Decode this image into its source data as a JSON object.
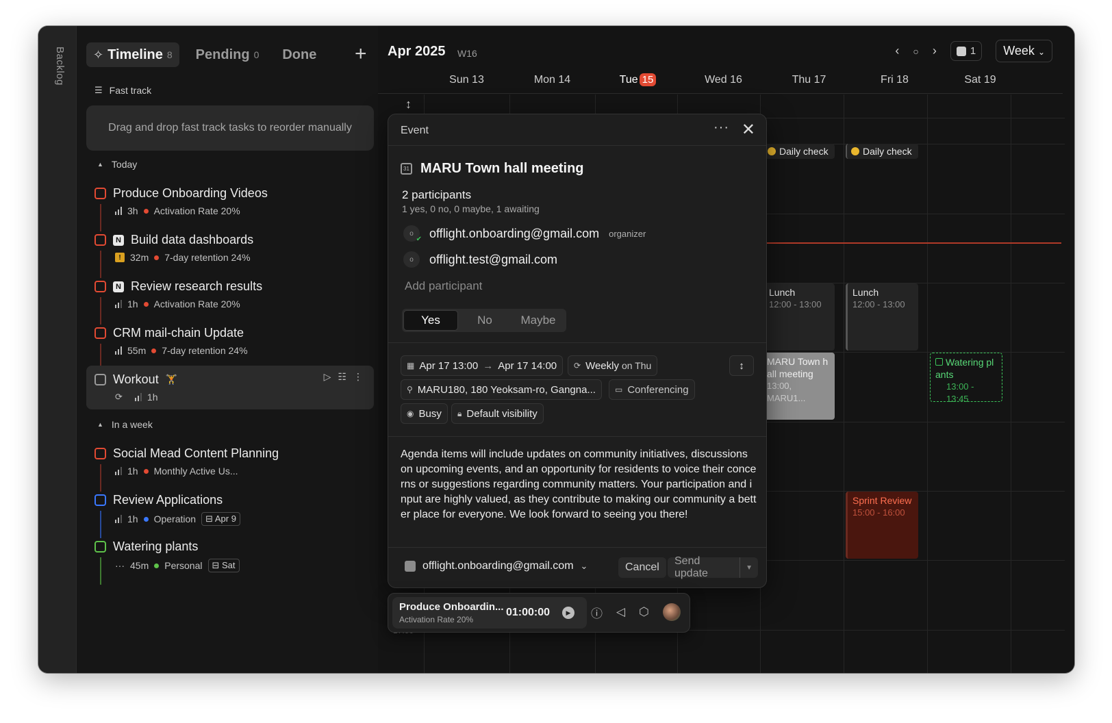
{
  "backlog_label": "Backlog",
  "tabs": [
    {
      "label": "Timeline",
      "count": "8"
    },
    {
      "label": "Pending",
      "count": "0"
    },
    {
      "label": "Done",
      "count": ""
    }
  ],
  "add_label": "+",
  "fast_track": {
    "label": "Fast track",
    "drop_hint": "Drag and drop fast track tasks to reorder manually"
  },
  "sections": {
    "today": "Today",
    "in_a_week": "In a week"
  },
  "tasks": [
    {
      "title": "Produce Onboarding Videos",
      "duration": "3h",
      "goal": "Activation Rate 20%",
      "goal_color": "#e24a33",
      "checkbox_color": "#e24a33"
    },
    {
      "title": "Build data dashboards",
      "duration": "32m",
      "goal": "7-day retention 24%",
      "goal_color": "#e24a33",
      "checkbox_color": "#e24a33",
      "app_icon": "N"
    },
    {
      "title": "Review research results",
      "duration": "1h",
      "goal": "Activation Rate 20%",
      "goal_color": "#e24a33",
      "checkbox_color": "#e24a33",
      "app_icon": "N"
    },
    {
      "title": "CRM mail-chain Update",
      "duration": "55m",
      "goal": "7-day retention 24%",
      "goal_color": "#e24a33",
      "checkbox_color": "#e24a33"
    },
    {
      "title": "Workout",
      "emoji": "🏋",
      "duration": "1h",
      "checkbox_color": "#9a9a9a"
    },
    {
      "title": "Social Mead Content Planning",
      "duration": "1h",
      "goal": "Monthly Active Us...",
      "goal_color": "#e24a33",
      "checkbox_color": "#e24a33"
    },
    {
      "title": "Review Applications",
      "duration": "1h",
      "goal": "Operation",
      "goal_color": "#3a78ff",
      "due": "Apr 9",
      "checkbox_color": "#3a78ff"
    },
    {
      "title": "Watering plants",
      "duration": "45m",
      "goal": "Personal",
      "goal_color": "#5ec24a",
      "due": "Sat",
      "checkbox_color": "#5ec24a",
      "duration_icon": "···"
    }
  ],
  "calendar": {
    "month": "Apr 2025",
    "week": "W16",
    "filter_count": "1",
    "view": "Week",
    "days": [
      "Sun 13",
      "Mon 14",
      "Tue",
      "Wed 16",
      "Thu 17",
      "Fri 18",
      "Sat 19"
    ],
    "today_num": "15",
    "hour_label": "17:00",
    "events": {
      "daily_thu": "Daily check",
      "daily_fri": "Daily check",
      "lunch_thu": {
        "title": "Lunch",
        "time": "12:00 - 13:00"
      },
      "lunch_fri": {
        "title": "Lunch",
        "time": "12:00 - 13:00"
      },
      "maru": {
        "title": "MARU Town h all meeting",
        "time": "13:00, MARU1..."
      },
      "water": {
        "title": "Watering pl ants",
        "time": "13:00 - 13:45"
      },
      "sprint": {
        "title": "Sprint Review",
        "time": "15:00 - 16:00"
      }
    }
  },
  "popover": {
    "header": "Event",
    "title": "MARU Town hall meeting",
    "participants_title": "2 participants",
    "participants_summary": "1 yes, 0 no, 0 maybe, 1 awaiting",
    "participants": [
      {
        "initial": "o",
        "email": "offlight.onboarding@gmail.com",
        "role": "organizer"
      },
      {
        "initial": "o",
        "email": "offlight.test@gmail.com",
        "role": ""
      }
    ],
    "add_participant_placeholder": "Add participant",
    "rsvp": {
      "yes": "Yes",
      "no": "No",
      "maybe": "Maybe",
      "selected": "Yes"
    },
    "start": "Apr 17  13:00",
    "end": "Apr 17  14:00",
    "recurrence_main": "Weekly",
    "recurrence_sub": "on Thu",
    "location": "MARU180, 180 Yeoksam-ro, Gangna...",
    "conferencing": "Conferencing",
    "busy": "Busy",
    "visibility": "Default visibility",
    "description": "Agenda items will include updates on community initiatives, discussions on upcoming events, and an opportunity for residents to voice their concerns or suggestions regarding community matters. Your participation and input are highly valued, as they contribute to making our community a better place for everyone. We look forward to seeing you there!",
    "account": "offlight.onboarding@gmail.com",
    "cancel": "Cancel",
    "send_update": "Send update"
  },
  "timer": {
    "task": "Produce Onboardin...",
    "goal": "Activation Rate 20%",
    "time": "01:00:00"
  }
}
